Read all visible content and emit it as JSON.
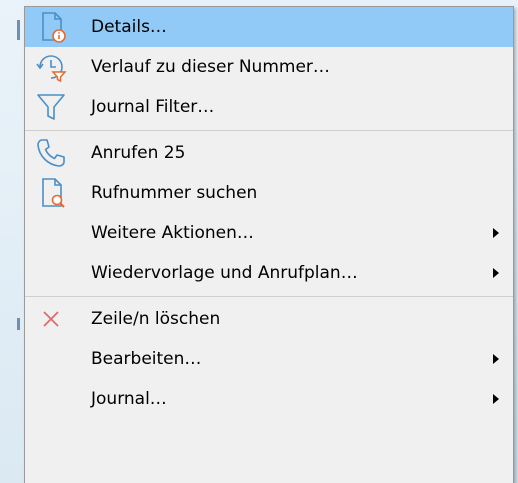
{
  "menu": {
    "items": [
      {
        "label": "Details…",
        "icon": "document-info-icon",
        "highlighted": true
      },
      {
        "label": "Verlauf zu dieser Nummer…",
        "icon": "history-filter-icon"
      },
      {
        "label": "Journal Filter…",
        "icon": "funnel-icon"
      },
      {
        "label": "Anrufen 25",
        "icon": "phone-icon"
      },
      {
        "label": "Rufnummer suchen",
        "icon": "document-search-icon"
      },
      {
        "label": "Weitere Aktionen…",
        "submenu": true
      },
      {
        "label": "Wiedervorlage und Anrufplan…",
        "submenu": true
      },
      {
        "label": "Zeile/n löschen",
        "icon": "delete-x-icon"
      },
      {
        "label": "Bearbeiten…",
        "submenu": true
      },
      {
        "label": "Journal…",
        "submenu": true
      }
    ]
  },
  "colors": {
    "highlight": "#91c9f7",
    "icon_blue": "#4a8fc8",
    "icon_orange": "#e56b2c",
    "delete_red": "#e06b6b"
  }
}
